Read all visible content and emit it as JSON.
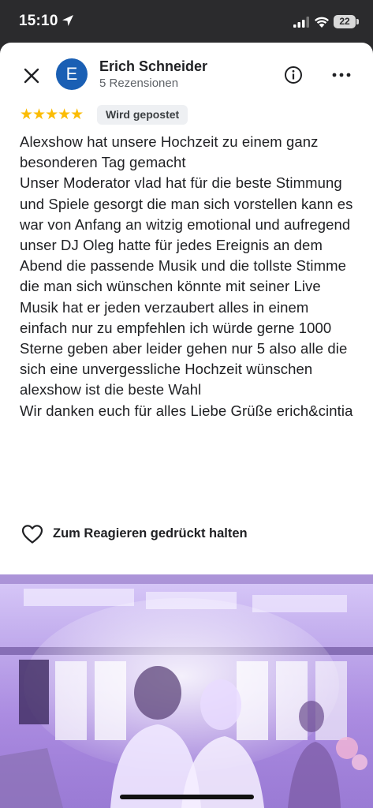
{
  "status_bar": {
    "time": "15:10",
    "battery": "22",
    "icons": [
      "location-arrow-icon",
      "signal-icon",
      "wifi-icon",
      "battery-icon"
    ]
  },
  "header": {
    "close_icon": "close-icon",
    "avatar_initial": "E",
    "avatar_color": "#1a5fb4",
    "reviewer_name": "Erich Schneider",
    "review_count": "5 Rezensionen",
    "info_icon": "info-icon",
    "more_icon": "more-horizontal-icon"
  },
  "rating": {
    "stars": 5,
    "stars_display": "★★★★★",
    "star_color": "#fbbc04",
    "status_badge": "Wird gepostet"
  },
  "review": {
    "text": "Alexshow hat unsere Hochzeit zu einem ganz besonderen Tag gemacht\nUnser Moderator vlad hat für die beste Stimmung und Spiele gesorgt die man sich vorstellen kann es war von Anfang an witzig emotional und aufregend unser DJ Oleg hatte für jedes Ereignis an dem Abend die passende Musik und die tollste Stimme die man sich wünschen könnte mit seiner Live Musik hat er jeden verzaubert alles in einem einfach nur zu empfehlen ich würde gerne 1000 Sterne geben aber leider gehen nur 5 also alle die sich eine unvergessliche Hochzeit wünschen alexshow ist die beste Wahl\nWir danken euch für alles Liebe Grüße erich&cintia"
  },
  "reaction": {
    "icon": "heart-outline-icon",
    "label": "Zum Reagieren gedrückt halten"
  },
  "photo": {
    "icon": "review-photo"
  }
}
